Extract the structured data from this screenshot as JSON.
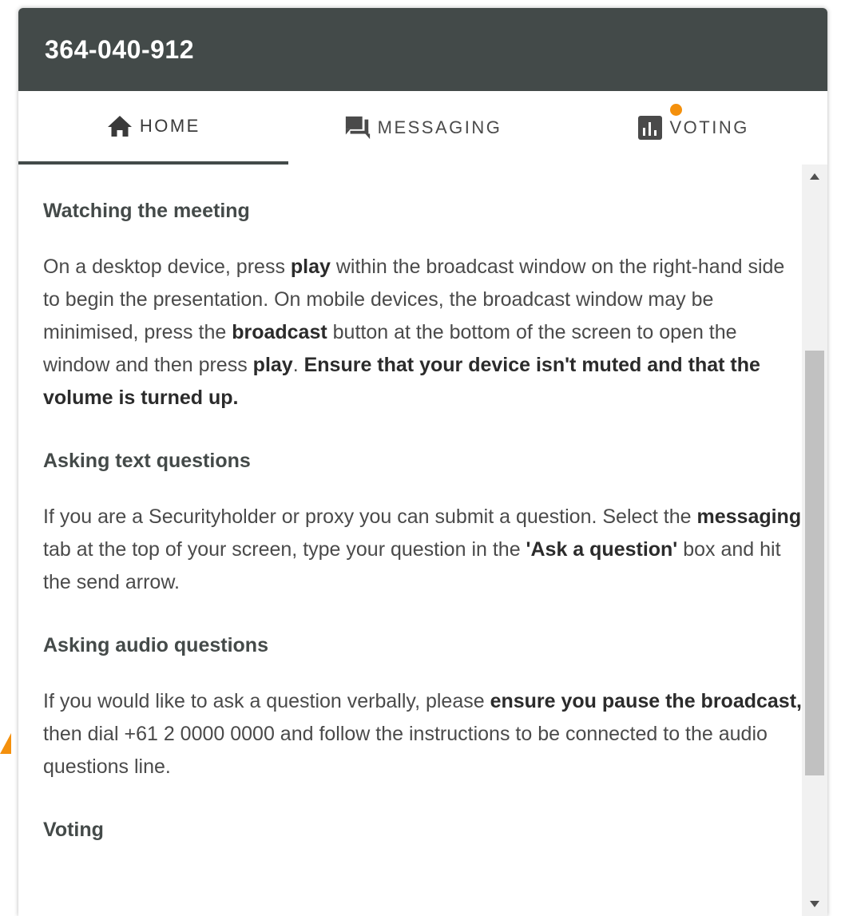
{
  "header": {
    "title": "364-040-912"
  },
  "tabs": [
    {
      "label": "HOME",
      "icon": "home-icon",
      "active": true
    },
    {
      "label": "MESSAGING",
      "icon": "chat-icon",
      "active": false
    },
    {
      "label": "VOTING",
      "icon": "bar-chart-icon",
      "active": false,
      "notification": true
    }
  ],
  "colors": {
    "header_bg": "#434a49",
    "notification": "#f4900c",
    "arrow_hint": "#f4900c"
  },
  "content": {
    "sections": [
      {
        "heading": "Watching the meeting",
        "body": [
          {
            "t": "On a desktop device, press "
          },
          {
            "t": "play",
            "b": true
          },
          {
            "t": " within the broadcast window on the right-hand side to begin the presentation. On mobile devices, the broadcast window may be minimised, press the "
          },
          {
            "t": "broadcast",
            "b": true
          },
          {
            "t": " button at the bottom of the screen to open the window and then press "
          },
          {
            "t": "play",
            "b": true
          },
          {
            "t": ". "
          },
          {
            "t": "Ensure that your device isn't muted and that the volume is turned up.",
            "b": true
          }
        ]
      },
      {
        "heading": "Asking text questions",
        "body": [
          {
            "t": "If you are a Securityholder or proxy you can submit a question. Select the "
          },
          {
            "t": "messaging",
            "b": true
          },
          {
            "t": " tab at the top of your screen, type your question in the "
          },
          {
            "t": "'Ask a question'",
            "b": true
          },
          {
            "t": " box and hit the send arrow."
          }
        ]
      },
      {
        "heading": "Asking audio questions",
        "body": [
          {
            "t": "If you would like to ask a question verbally, please "
          },
          {
            "t": "ensure you pause the broadcast,",
            "b": true
          },
          {
            "t": " then dial +61 2 0000 0000 and follow the instructions to be connected to the audio questions line."
          }
        ]
      },
      {
        "heading": "Voting",
        "body": []
      }
    ]
  }
}
